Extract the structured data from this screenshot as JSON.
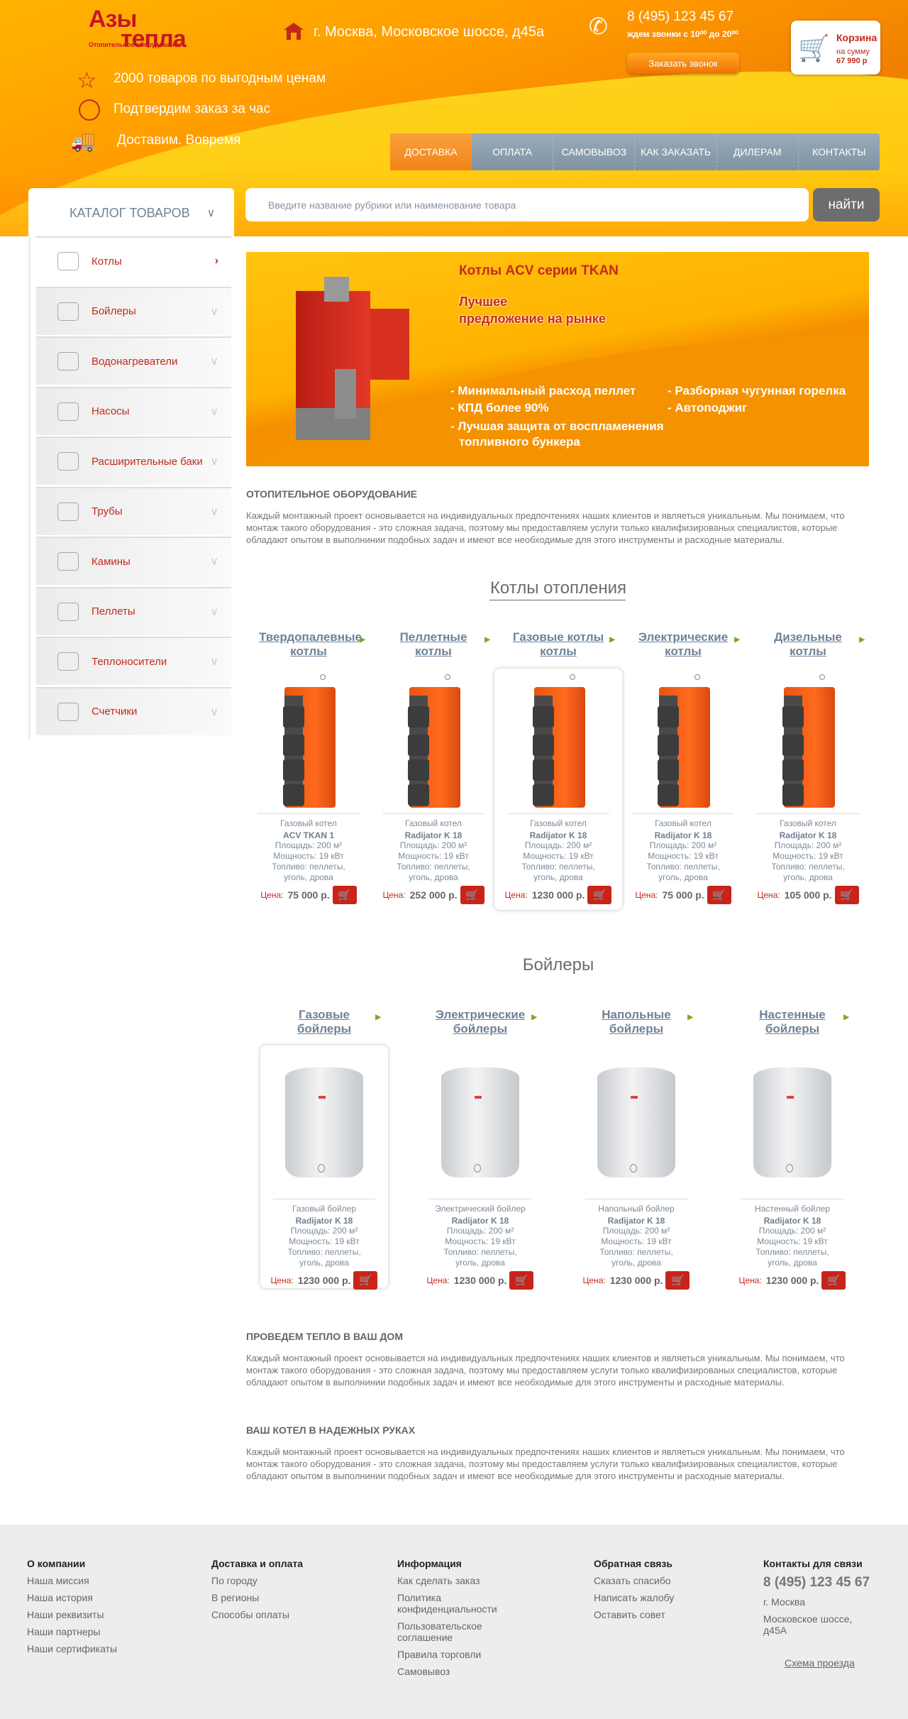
{
  "header": {
    "logo_line1": "Азы",
    "logo_line2": "тепла",
    "logo_tagline": "Отопительное оборудование",
    "address": "г. Москва, Московское шоссе, д45а",
    "phone": "8 (495) 123 45 67",
    "hours": "ждем звонки с 10⁰⁰ до 20⁰⁰",
    "callback_button": "Заказать звонок",
    "cart": {
      "label": "Корзина",
      "sum_label": "на сумму",
      "sum": "67 990 р"
    },
    "features": [
      {
        "icon": "star-icon",
        "text": "2000 товаров по выгодным ценам"
      },
      {
        "icon": "clock-icon",
        "text": "Подтвердим заказ за час"
      },
      {
        "icon": "truck-icon",
        "text": "Доставим. Вовремя"
      }
    ]
  },
  "nav": [
    {
      "label": "ДОСТАВКА",
      "active": true
    },
    {
      "label": "ОПЛАТА"
    },
    {
      "label": "САМОВЫВОЗ"
    },
    {
      "label": "КАК ЗАКАЗАТЬ"
    },
    {
      "label": "ДИЛЕРАМ"
    },
    {
      "label": "КОНТАКТЫ"
    }
  ],
  "catalog": {
    "title": "КАТАЛОГ ТОВАРОВ",
    "items": [
      {
        "label": "Котлы",
        "icon": "grill-icon"
      },
      {
        "label": "Бойлеры",
        "icon": "fridge-icon"
      },
      {
        "label": "Водонагреватели",
        "icon": "heater-icon"
      },
      {
        "label": "Насосы",
        "icon": "pump-icon"
      },
      {
        "label": "Расширительные баки",
        "icon": "tank-icon"
      },
      {
        "label": "Трубы",
        "icon": "faucet-icon"
      },
      {
        "label": "Камины",
        "icon": "fireplace-icon"
      },
      {
        "label": "Пеллеты",
        "icon": "pellets-icon"
      },
      {
        "label": "Теплоносители",
        "icon": "heat-icon"
      },
      {
        "label": "Счетчики",
        "icon": "meter-icon"
      }
    ]
  },
  "search": {
    "placeholder": "Введите название рубрики или наименование товара",
    "button": "найти"
  },
  "banner": {
    "title": "Котлы ACV серии TKAN",
    "subtitle1": "Лучшее",
    "subtitle2": "предложение на рынке",
    "bullets_left": [
      "- Минимальный расход пеллет",
      "- КПД более 90%",
      "- Лучшая защита от воспламенения",
      "топливного бункера"
    ],
    "bullets_right": [
      "- Разборная чугунная горелка",
      "- Автоподжиг"
    ]
  },
  "intro": {
    "heading": "ОТОПИТЕЛЬНОЕ ОБОРУДОВАНИЕ",
    "text": "Каждый монтажный проект основывается на индивидуальных предпочтениях наших клиентов и являеться уникальным. Мы понимаем, что монтаж такого оборудования - это сложная задача, поэтому мы предоставляем услуги только квалифизированых специалистов, которые обладают опытом в выполнинии подобных задач и имеют все необходимые для этого инструменты   и расходные материалы."
  },
  "boilers_section": {
    "title": "Котлы отопления",
    "price_label": "Цена:",
    "categories": [
      "Твердопалевные котлы",
      "Пеллетные котлы",
      "Газовые котлы котлы",
      "Электрические котлы",
      "Дизельные котлы"
    ],
    "products": [
      {
        "type": "Газовый  котел",
        "name": "ACV TKAN 1",
        "area": "Площадь: 200 м²",
        "power": "Мощность: 19 кВт",
        "fuel": "Топливо:   пеллеты, уголь, дрова",
        "price": "75 000 р."
      },
      {
        "type": "Газовый  котел",
        "name": "Radijator K 18",
        "area": "Площадь: 200 м²",
        "power": "Мощность: 19 кВт",
        "fuel": "Топливо:   пеллеты, уголь, дрова",
        "price": "252 000 р."
      },
      {
        "type": "Газовый  котел",
        "name": "Radijator K 18",
        "area": "Площадь: 200 м²",
        "power": "Мощность: 19 кВт",
        "fuel": "Топливо:   пеллеты, уголь, дрова",
        "price": "1230 000 р.",
        "highlighted": true
      },
      {
        "type": "Газовый  котел",
        "name": "Radijator K 18",
        "area": "Площадь: 200 м²",
        "power": "Мощность: 19 кВт",
        "fuel": "Топливо:   пеллеты, уголь, дрова",
        "price": "75 000 р."
      },
      {
        "type": "Газовый  котел",
        "name": "Radijator K 18",
        "area": "Площадь: 200 м²",
        "power": "Мощность: 19 кВт",
        "fuel": "Топливо:   пеллеты, уголь, дрова",
        "price": "105 000 р."
      }
    ]
  },
  "heaters_section": {
    "title": "Бойлеры",
    "price_label": "Цена:",
    "categories": [
      "Газовые бойлеры",
      "Электрические бойлеры",
      "Напольные бойлеры",
      "Настенные бойлеры"
    ],
    "products": [
      {
        "type": "Газовый  бойлер",
        "name": "Radijator K 18",
        "area": "Площадь: 200 м²",
        "power": "Мощность: 19 кВт",
        "fuel": "Топливо:   пеллеты, уголь, дрова",
        "price": "1230 000 р.",
        "highlighted": true
      },
      {
        "type": "Электрический  бойлер",
        "name": "Radijator K 18",
        "area": "Площадь: 200 м²",
        "power": "Мощность: 19 кВт",
        "fuel": "Топливо:   пеллеты, уголь, дрова",
        "price": "1230 000 р."
      },
      {
        "type": "Напольный бойлер",
        "name": "Radijator K 18",
        "area": "Площадь: 200 м²",
        "power": "Мощность: 19 кВт",
        "fuel": "Топливо:   пеллеты, уголь, дрова",
        "price": "1230 000 р."
      },
      {
        "type": "Настенный бойлер",
        "name": "Radijator K 18",
        "area": "Площадь: 200 м²",
        "power": "Мощность: 19 кВт",
        "fuel": "Топливо:   пеллеты, уголь, дрова",
        "price": "1230 000 р."
      }
    ]
  },
  "info1": {
    "heading": "ПРОВЕДЕМ ТЕПЛО В ВАШ ДОМ",
    "text": "Каждый монтажный проект основывается на индивидуальных предпочтениях наших клиентов и являеться уникальным. Мы понимаем, что монтаж такого оборудования - это сложная задача, поэтому мы предоставляем услуги только квалифизированых специалистов, которые обладают опытом в выполнинии подобных задач и имеют все необходимые для этого инструменты   и расходные материалы."
  },
  "info2": {
    "heading": "ВАШ КОТЕЛ В НАДЕЖНЫХ РУКАХ",
    "text": "Каждый монтажный проект основывается на индивидуальных предпочтениях наших клиентов и являеться уникальным. Мы понимаем, что монтаж такого оборудования - это сложная задача, поэтому мы предоставляем услуги только квалифизированых специалистов, которые обладают опытом в выполнинии подобных задач и имеют все необходимые для этого инструменты   и расходные материалы."
  },
  "footer": {
    "columns": [
      {
        "heading": "О компании",
        "items": [
          "Наша миссия",
          "Наша история",
          "Наши реквизиты",
          "Наши партнеры",
          "Наши сертификаты"
        ]
      },
      {
        "heading": "Доставка и оплата",
        "items": [
          "По городу",
          "В регионы",
          "Способы оплаты"
        ]
      },
      {
        "heading": "Информация",
        "items": [
          "Как сделать заказ",
          "Политика конфиденциальности",
          "Пользовательское соглашение",
          "Правила торговли",
          "Самовывоз"
        ]
      },
      {
        "heading": "Обратная связь",
        "items": [
          "Сказать спасибо",
          "Написать жалобу",
          "Оставить совет"
        ]
      }
    ],
    "contacts": {
      "heading": "Контакты для связи",
      "phone": "8 (495) 123 45 67",
      "city": "г. Москва",
      "street": "Московское шоссе, д45А",
      "map_link": "Схема проезда"
    }
  },
  "colors": {
    "accent_red": "#c42a1c",
    "nav_gray": "#8a9cad",
    "orange": "#f28418"
  }
}
